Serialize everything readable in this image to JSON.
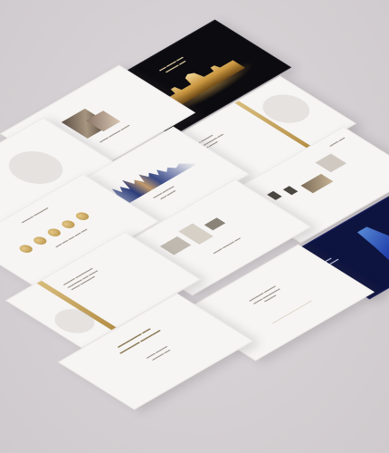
{
  "scene": {
    "description_colors": {
      "background": "#d5d0d3",
      "slide_light": "#f6f5f4",
      "accent_gold": "#b08f4e",
      "slide_dark": "#0c0b0f",
      "slide_navy": "#0e1440"
    }
  },
  "slides": {
    "s1_title": "",
    "s8_title": "",
    "s11_title": "",
    "s12_title": ""
  }
}
